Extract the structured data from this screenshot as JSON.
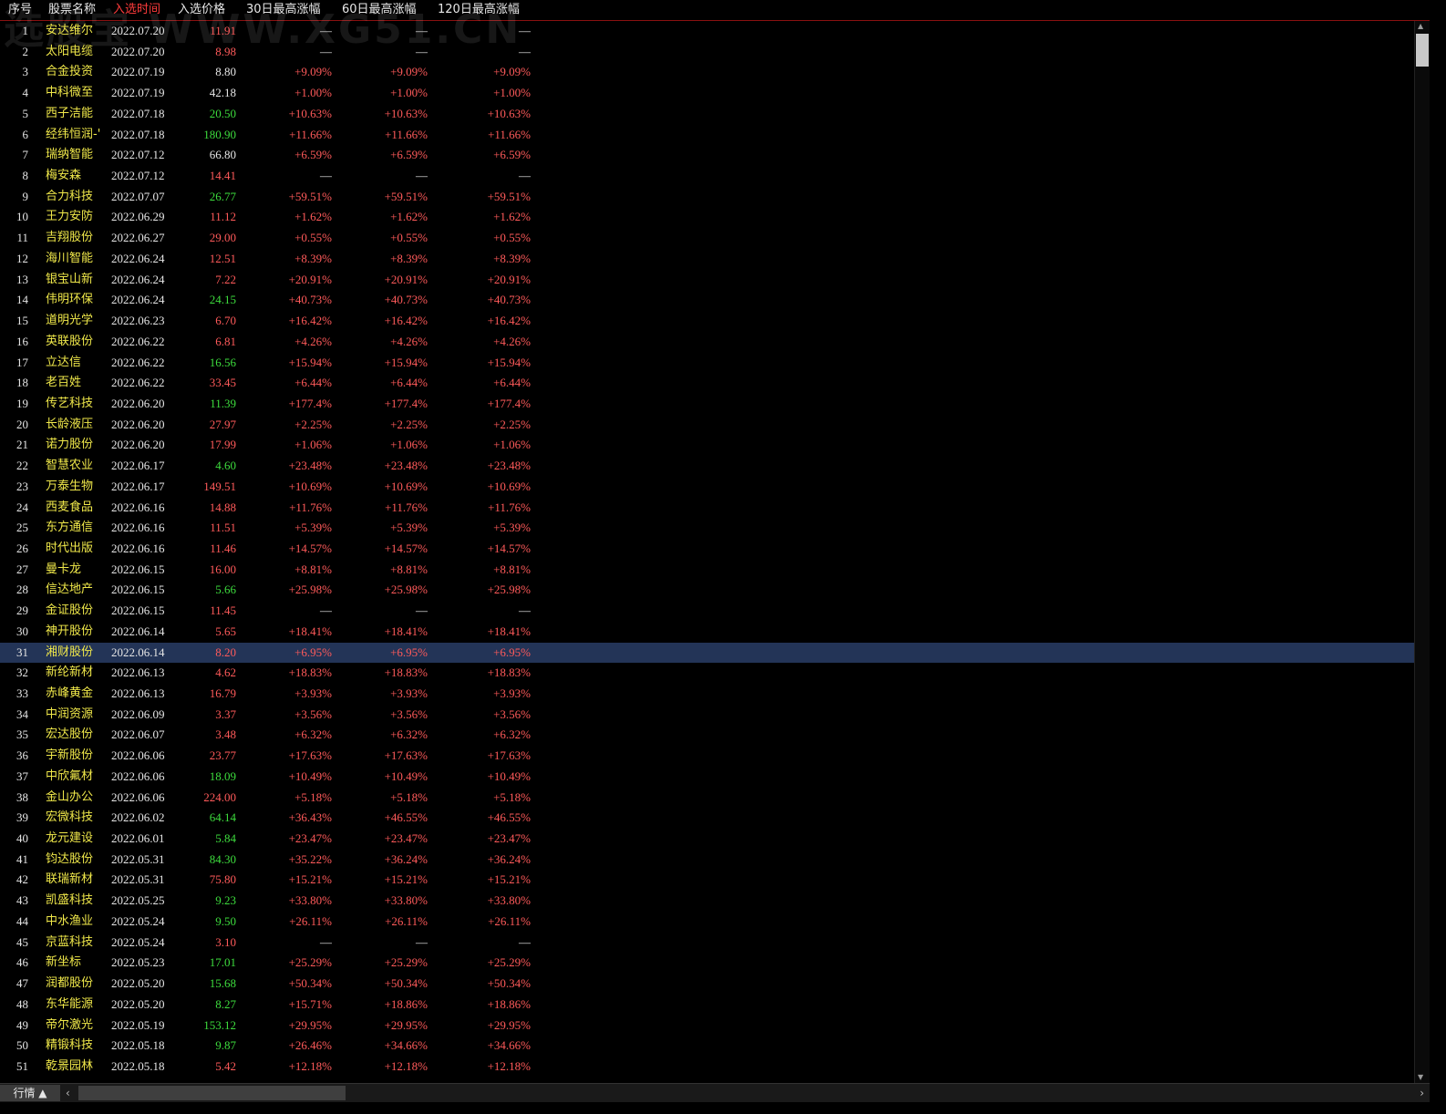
{
  "watermark": "选股宝 WWW.XG51.CN",
  "columns": {
    "idx": "序号",
    "name": "股票名称",
    "date": "入选时间",
    "price": "入选价格",
    "g30": "30日最高涨幅",
    "g60": "60日最高涨幅",
    "g120": "120日最高涨幅"
  },
  "colors": {
    "red": "#ff5a5a",
    "green": "#3ddc3d",
    "white": "#e6e6e6",
    "yellow": "#f0e84a"
  },
  "rows": [
    {
      "idx": "1",
      "name": "安达维尔",
      "date": "2022.07.20",
      "price": "11.91",
      "pc": "red",
      "g30": "—",
      "g60": "—",
      "g120": "—"
    },
    {
      "idx": "2",
      "name": "太阳电缆",
      "date": "2022.07.20",
      "price": "8.98",
      "pc": "red",
      "g30": "—",
      "g60": "—",
      "g120": "—"
    },
    {
      "idx": "3",
      "name": "合金投资",
      "date": "2022.07.19",
      "price": "8.80",
      "pc": "white",
      "g30": "+9.09%",
      "g60": "+9.09%",
      "g120": "+9.09%"
    },
    {
      "idx": "4",
      "name": "中科微至",
      "date": "2022.07.19",
      "price": "42.18",
      "pc": "white",
      "g30": "+1.00%",
      "g60": "+1.00%",
      "g120": "+1.00%"
    },
    {
      "idx": "5",
      "name": "西子洁能",
      "date": "2022.07.18",
      "price": "20.50",
      "pc": "green",
      "g30": "+10.63%",
      "g60": "+10.63%",
      "g120": "+10.63%"
    },
    {
      "idx": "6",
      "name": "经纬恒润-'",
      "date": "2022.07.18",
      "price": "180.90",
      "pc": "green",
      "g30": "+11.66%",
      "g60": "+11.66%",
      "g120": "+11.66%"
    },
    {
      "idx": "7",
      "name": "瑞纳智能",
      "date": "2022.07.12",
      "price": "66.80",
      "pc": "white",
      "g30": "+6.59%",
      "g60": "+6.59%",
      "g120": "+6.59%"
    },
    {
      "idx": "8",
      "name": "梅安森",
      "date": "2022.07.12",
      "price": "14.41",
      "pc": "red",
      "g30": "—",
      "g60": "—",
      "g120": "—"
    },
    {
      "idx": "9",
      "name": "合力科技",
      "date": "2022.07.07",
      "price": "26.77",
      "pc": "green",
      "g30": "+59.51%",
      "g60": "+59.51%",
      "g120": "+59.51%"
    },
    {
      "idx": "10",
      "name": "王力安防",
      "date": "2022.06.29",
      "price": "11.12",
      "pc": "red",
      "g30": "+1.62%",
      "g60": "+1.62%",
      "g120": "+1.62%"
    },
    {
      "idx": "11",
      "name": "吉翔股份",
      "date": "2022.06.27",
      "price": "29.00",
      "pc": "red",
      "g30": "+0.55%",
      "g60": "+0.55%",
      "g120": "+0.55%"
    },
    {
      "idx": "12",
      "name": "海川智能",
      "date": "2022.06.24",
      "price": "12.51",
      "pc": "red",
      "g30": "+8.39%",
      "g60": "+8.39%",
      "g120": "+8.39%"
    },
    {
      "idx": "13",
      "name": "银宝山新",
      "date": "2022.06.24",
      "price": "7.22",
      "pc": "red",
      "g30": "+20.91%",
      "g60": "+20.91%",
      "g120": "+20.91%"
    },
    {
      "idx": "14",
      "name": "伟明环保",
      "date": "2022.06.24",
      "price": "24.15",
      "pc": "green",
      "g30": "+40.73%",
      "g60": "+40.73%",
      "g120": "+40.73%"
    },
    {
      "idx": "15",
      "name": "道明光学",
      "date": "2022.06.23",
      "price": "6.70",
      "pc": "red",
      "g30": "+16.42%",
      "g60": "+16.42%",
      "g120": "+16.42%"
    },
    {
      "idx": "16",
      "name": "英联股份",
      "date": "2022.06.22",
      "price": "6.81",
      "pc": "red",
      "g30": "+4.26%",
      "g60": "+4.26%",
      "g120": "+4.26%"
    },
    {
      "idx": "17",
      "name": "立达信",
      "date": "2022.06.22",
      "price": "16.56",
      "pc": "green",
      "g30": "+15.94%",
      "g60": "+15.94%",
      "g120": "+15.94%"
    },
    {
      "idx": "18",
      "name": "老百姓",
      "date": "2022.06.22",
      "price": "33.45",
      "pc": "red",
      "g30": "+6.44%",
      "g60": "+6.44%",
      "g120": "+6.44%"
    },
    {
      "idx": "19",
      "name": "传艺科技",
      "date": "2022.06.20",
      "price": "11.39",
      "pc": "green",
      "g30": "+177.4%",
      "g60": "+177.4%",
      "g120": "+177.4%"
    },
    {
      "idx": "20",
      "name": "长龄液压",
      "date": "2022.06.20",
      "price": "27.97",
      "pc": "red",
      "g30": "+2.25%",
      "g60": "+2.25%",
      "g120": "+2.25%"
    },
    {
      "idx": "21",
      "name": "诺力股份",
      "date": "2022.06.20",
      "price": "17.99",
      "pc": "red",
      "g30": "+1.06%",
      "g60": "+1.06%",
      "g120": "+1.06%"
    },
    {
      "idx": "22",
      "name": "智慧农业",
      "date": "2022.06.17",
      "price": "4.60",
      "pc": "green",
      "g30": "+23.48%",
      "g60": "+23.48%",
      "g120": "+23.48%"
    },
    {
      "idx": "23",
      "name": "万泰生物",
      "date": "2022.06.17",
      "price": "149.51",
      "pc": "red",
      "g30": "+10.69%",
      "g60": "+10.69%",
      "g120": "+10.69%"
    },
    {
      "idx": "24",
      "name": "西麦食品",
      "date": "2022.06.16",
      "price": "14.88",
      "pc": "red",
      "g30": "+11.76%",
      "g60": "+11.76%",
      "g120": "+11.76%"
    },
    {
      "idx": "25",
      "name": "东方通信",
      "date": "2022.06.16",
      "price": "11.51",
      "pc": "red",
      "g30": "+5.39%",
      "g60": "+5.39%",
      "g120": "+5.39%"
    },
    {
      "idx": "26",
      "name": "时代出版",
      "date": "2022.06.16",
      "price": "11.46",
      "pc": "red",
      "g30": "+14.57%",
      "g60": "+14.57%",
      "g120": "+14.57%"
    },
    {
      "idx": "27",
      "name": "曼卡龙",
      "date": "2022.06.15",
      "price": "16.00",
      "pc": "red",
      "g30": "+8.81%",
      "g60": "+8.81%",
      "g120": "+8.81%"
    },
    {
      "idx": "28",
      "name": "信达地产",
      "date": "2022.06.15",
      "price": "5.66",
      "pc": "green",
      "g30": "+25.98%",
      "g60": "+25.98%",
      "g120": "+25.98%"
    },
    {
      "idx": "29",
      "name": "金证股份",
      "date": "2022.06.15",
      "price": "11.45",
      "pc": "red",
      "g30": "—",
      "g60": "—",
      "g120": "—"
    },
    {
      "idx": "30",
      "name": "神开股份",
      "date": "2022.06.14",
      "price": "5.65",
      "pc": "red",
      "g30": "+18.41%",
      "g60": "+18.41%",
      "g120": "+18.41%"
    },
    {
      "idx": "31",
      "name": "湘财股份",
      "date": "2022.06.14",
      "price": "8.20",
      "pc": "red",
      "g30": "+6.95%",
      "g60": "+6.95%",
      "g120": "+6.95%",
      "selected": true
    },
    {
      "idx": "32",
      "name": "新纶新材",
      "date": "2022.06.13",
      "price": "4.62",
      "pc": "red",
      "g30": "+18.83%",
      "g60": "+18.83%",
      "g120": "+18.83%"
    },
    {
      "idx": "33",
      "name": "赤峰黄金",
      "date": "2022.06.13",
      "price": "16.79",
      "pc": "red",
      "g30": "+3.93%",
      "g60": "+3.93%",
      "g120": "+3.93%"
    },
    {
      "idx": "34",
      "name": "中润资源",
      "date": "2022.06.09",
      "price": "3.37",
      "pc": "red",
      "g30": "+3.56%",
      "g60": "+3.56%",
      "g120": "+3.56%"
    },
    {
      "idx": "35",
      "name": "宏达股份",
      "date": "2022.06.07",
      "price": "3.48",
      "pc": "red",
      "g30": "+6.32%",
      "g60": "+6.32%",
      "g120": "+6.32%"
    },
    {
      "idx": "36",
      "name": "宇新股份",
      "date": "2022.06.06",
      "price": "23.77",
      "pc": "red",
      "g30": "+17.63%",
      "g60": "+17.63%",
      "g120": "+17.63%"
    },
    {
      "idx": "37",
      "name": "中欣氟材",
      "date": "2022.06.06",
      "price": "18.09",
      "pc": "green",
      "g30": "+10.49%",
      "g60": "+10.49%",
      "g120": "+10.49%"
    },
    {
      "idx": "38",
      "name": "金山办公",
      "date": "2022.06.06",
      "price": "224.00",
      "pc": "red",
      "g30": "+5.18%",
      "g60": "+5.18%",
      "g120": "+5.18%"
    },
    {
      "idx": "39",
      "name": "宏微科技",
      "date": "2022.06.02",
      "price": "64.14",
      "pc": "green",
      "g30": "+36.43%",
      "g60": "+46.55%",
      "g120": "+46.55%"
    },
    {
      "idx": "40",
      "name": "龙元建设",
      "date": "2022.06.01",
      "price": "5.84",
      "pc": "green",
      "g30": "+23.47%",
      "g60": "+23.47%",
      "g120": "+23.47%"
    },
    {
      "idx": "41",
      "name": "钧达股份",
      "date": "2022.05.31",
      "price": "84.30",
      "pc": "green",
      "g30": "+35.22%",
      "g60": "+36.24%",
      "g120": "+36.24%"
    },
    {
      "idx": "42",
      "name": "联瑞新材",
      "date": "2022.05.31",
      "price": "75.80",
      "pc": "red",
      "g30": "+15.21%",
      "g60": "+15.21%",
      "g120": "+15.21%"
    },
    {
      "idx": "43",
      "name": "凯盛科技",
      "date": "2022.05.25",
      "price": "9.23",
      "pc": "green",
      "g30": "+33.80%",
      "g60": "+33.80%",
      "g120": "+33.80%"
    },
    {
      "idx": "44",
      "name": "中水渔业",
      "date": "2022.05.24",
      "price": "9.50",
      "pc": "green",
      "g30": "+26.11%",
      "g60": "+26.11%",
      "g120": "+26.11%"
    },
    {
      "idx": "45",
      "name": "京蓝科技",
      "date": "2022.05.24",
      "price": "3.10",
      "pc": "red",
      "g30": "—",
      "g60": "—",
      "g120": "—"
    },
    {
      "idx": "46",
      "name": "新坐标",
      "date": "2022.05.23",
      "price": "17.01",
      "pc": "green",
      "g30": "+25.29%",
      "g60": "+25.29%",
      "g120": "+25.29%"
    },
    {
      "idx": "47",
      "name": "润都股份",
      "date": "2022.05.20",
      "price": "15.68",
      "pc": "green",
      "g30": "+50.34%",
      "g60": "+50.34%",
      "g120": "+50.34%"
    },
    {
      "idx": "48",
      "name": "东华能源",
      "date": "2022.05.20",
      "price": "8.27",
      "pc": "green",
      "g30": "+15.71%",
      "g60": "+18.86%",
      "g120": "+18.86%"
    },
    {
      "idx": "49",
      "name": "帝尔激光",
      "date": "2022.05.19",
      "price": "153.12",
      "pc": "green",
      "g30": "+29.95%",
      "g60": "+29.95%",
      "g120": "+29.95%"
    },
    {
      "idx": "50",
      "name": "精锻科技",
      "date": "2022.05.18",
      "price": "9.87",
      "pc": "green",
      "g30": "+26.46%",
      "g60": "+34.66%",
      "g120": "+34.66%"
    },
    {
      "idx": "51",
      "name": "乾景园林",
      "date": "2022.05.18",
      "price": "5.42",
      "pc": "red",
      "g30": "+12.18%",
      "g60": "+12.18%",
      "g120": "+12.18%"
    }
  ],
  "bottom": {
    "tab_label": "行情 ▲",
    "left_arrow": "‹",
    "right_arrow": "›"
  },
  "scroll": {
    "up_arrow": "▲",
    "down_arrow": "▼"
  }
}
